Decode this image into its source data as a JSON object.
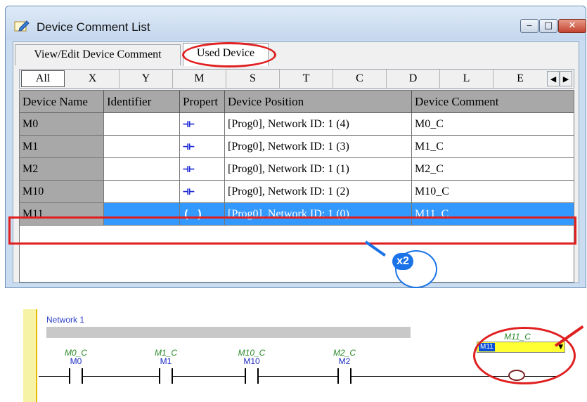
{
  "window": {
    "title": "Device Comment List",
    "controls": {
      "minimize": "‒",
      "maximize": "□",
      "close": "✕"
    }
  },
  "tabs": [
    {
      "label": "View/Edit Device Comment",
      "selected": false
    },
    {
      "label": "Used Device",
      "selected": true
    }
  ],
  "device_types": [
    "All",
    "X",
    "Y",
    "M",
    "S",
    "T",
    "C",
    "D",
    "L",
    "E"
  ],
  "nav_arrows": {
    "left": "◀",
    "right": "▶"
  },
  "table": {
    "columns": [
      "Device Name",
      "Identifier",
      "Propert",
      "Device Position",
      "Device Comment"
    ],
    "rows": [
      {
        "name": "M0",
        "identifier": "",
        "property": "⊣⊢",
        "position": "[Prog0], Network ID: 1 (4)",
        "comment": "M0_C",
        "selected": false
      },
      {
        "name": "M1",
        "identifier": "",
        "property": "⊣⊢",
        "position": "[Prog0], Network ID: 1 (3)",
        "comment": "M1_C",
        "selected": false
      },
      {
        "name": "M2",
        "identifier": "",
        "property": "⊣⊢",
        "position": "[Prog0], Network ID: 1 (1)",
        "comment": "M2_C",
        "selected": false
      },
      {
        "name": "M10",
        "identifier": "",
        "property": "⊣⊢",
        "position": "[Prog0], Network ID: 1 (2)",
        "comment": "M10_C",
        "selected": false
      },
      {
        "name": "M11",
        "identifier": "",
        "property": "(  )",
        "position": "[Prog0], Network ID: 1 (0)",
        "comment": "M11_C",
        "selected": true
      }
    ]
  },
  "cursor_badge": "x2",
  "ladder": {
    "network_label": "Network 1",
    "contacts": [
      {
        "comment": "M0_C",
        "device": "M0"
      },
      {
        "comment": "M1_C",
        "device": "M1"
      },
      {
        "comment": "M10_C",
        "device": "M10"
      },
      {
        "comment": "M2_C",
        "device": "M2"
      }
    ],
    "coil": {
      "comment": "M11_C",
      "device": "M11"
    }
  },
  "colors": {
    "selection": "#3399ff",
    "highlight": "#e02020",
    "header": "#a8a8a8"
  }
}
